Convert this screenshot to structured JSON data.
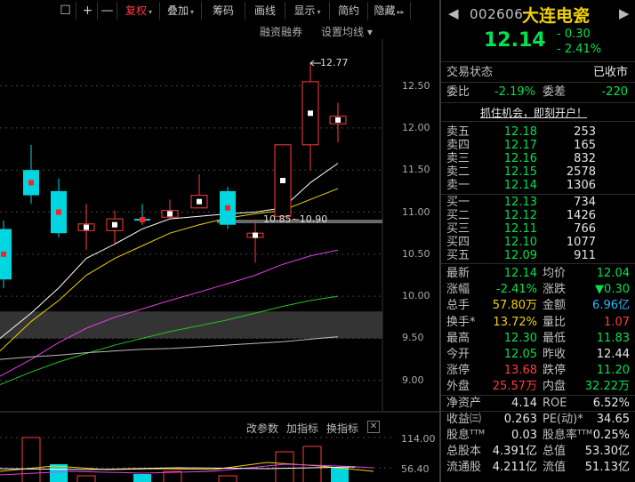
{
  "toolbar": {
    "items": [
      {
        "label": "☐",
        "icon": "window-icon"
      },
      {
        "label": "+",
        "icon": "zoom-in-icon"
      },
      {
        "label": "—",
        "icon": "zoom-out-icon"
      },
      {
        "label": "复权",
        "caret": "▾",
        "active": true
      },
      {
        "label": "叠加",
        "caret": "▾"
      },
      {
        "label": "筹码"
      },
      {
        "label": "画线"
      },
      {
        "label": "显示",
        "caret": "▾"
      },
      {
        "label": "简约"
      },
      {
        "label": "隐藏",
        "caret": "▸▸"
      }
    ],
    "margin_trading": "融资融券",
    "ma_setting": "设置均线 ▾"
  },
  "price_axis": [
    "12.50",
    "12.00",
    "11.50",
    "11.00",
    "10.50",
    "10.00",
    "9.50",
    "9.00"
  ],
  "annotations": {
    "high_label": "12.77",
    "range_label": "10.85~10.90"
  },
  "sub_panel": {
    "labels": [
      "改参数",
      "加指标",
      "换指标"
    ],
    "close": "✕",
    "axis": [
      "114.00",
      "56.40"
    ]
  },
  "chart_data": {
    "type": "candlestick",
    "candles": [
      {
        "open": 10.8,
        "close": 10.2,
        "high": 10.9,
        "low": 10.1
      },
      {
        "open": 11.5,
        "close": 11.2,
        "high": 11.8,
        "low": 11.1
      },
      {
        "open": 11.25,
        "close": 10.75,
        "high": 11.4,
        "low": 10.7
      },
      {
        "open": 10.78,
        "close": 10.86,
        "high": 11.1,
        "low": 10.55
      },
      {
        "open": 10.78,
        "close": 10.92,
        "high": 11.02,
        "low": 10.62
      },
      {
        "open": 10.92,
        "close": 10.9,
        "high": 11.1,
        "low": 10.85
      },
      {
        "open": 10.94,
        "close": 11.02,
        "high": 11.15,
        "low": 10.92
      },
      {
        "open": 11.05,
        "close": 11.2,
        "high": 11.45,
        "low": 11.05
      },
      {
        "open": 11.25,
        "close": 10.85,
        "high": 11.3,
        "low": 10.8
      },
      {
        "open": 10.7,
        "close": 10.75,
        "high": 10.9,
        "low": 10.4
      },
      {
        "open": 10.95,
        "close": 11.8,
        "high": 11.8,
        "low": 10.95
      },
      {
        "open": 11.8,
        "close": 12.55,
        "high": 12.77,
        "low": 11.5
      },
      {
        "open": 12.05,
        "close": 12.14,
        "high": 12.3,
        "low": 11.83
      }
    ],
    "ma_lines": [
      {
        "color": "#ffffff",
        "values": [
          9.5,
          9.8,
          10.1,
          10.45,
          10.62,
          10.8,
          10.92,
          10.95,
          10.98,
          11.0,
          11.05,
          11.35,
          11.58
        ]
      },
      {
        "color": "#f0d200",
        "values": [
          9.35,
          9.7,
          9.95,
          10.25,
          10.45,
          10.6,
          10.75,
          10.85,
          10.93,
          10.98,
          11.02,
          11.15,
          11.28
        ]
      },
      {
        "color": "#e040e0",
        "values": [
          9.05,
          9.25,
          9.45,
          9.62,
          9.75,
          9.85,
          9.95,
          10.05,
          10.15,
          10.25,
          10.38,
          10.48,
          10.55
        ]
      },
      {
        "color": "#22c322",
        "values": [
          8.95,
          9.1,
          9.22,
          9.32,
          9.42,
          9.5,
          9.58,
          9.65,
          9.72,
          9.8,
          9.88,
          9.95,
          10.0
        ]
      },
      {
        "color": "#bbbbbb",
        "values": [
          9.25,
          9.28,
          9.3,
          9.33,
          9.35,
          9.37,
          9.38,
          9.4,
          9.42,
          9.44,
          9.46,
          9.49,
          9.52
        ]
      }
    ],
    "support_band": [
      9.5,
      9.82
    ],
    "ylim": [
      8.85,
      12.95
    ]
  },
  "quote": {
    "code": "002606",
    "name": "大连电瓷",
    "price": "12.14",
    "change": "- 0.30",
    "change_pct": "- 2.41%",
    "status_label": "交易状态",
    "status_value": "已收市",
    "wb_label": "委比",
    "wb_value": "-2.19%",
    "wc_label": "委差",
    "wc_value": "-220",
    "promo": "抓住机会，即刻开户！"
  },
  "orderbook": {
    "asks": [
      {
        "label": "卖五",
        "price": "12.18",
        "vol": "253"
      },
      {
        "label": "卖四",
        "price": "12.17",
        "vol": "165"
      },
      {
        "label": "卖三",
        "price": "12.16",
        "vol": "832"
      },
      {
        "label": "卖二",
        "price": "12.15",
        "vol": "2578"
      },
      {
        "label": "卖一",
        "price": "12.14",
        "vol": "1306"
      }
    ],
    "bids": [
      {
        "label": "买一",
        "price": "12.13",
        "vol": "734"
      },
      {
        "label": "买二",
        "price": "12.12",
        "vol": "1426"
      },
      {
        "label": "买三",
        "price": "12.11",
        "vol": "766"
      },
      {
        "label": "买四",
        "price": "12.10",
        "vol": "1077"
      },
      {
        "label": "买五",
        "price": "12.09",
        "vol": "911"
      }
    ]
  },
  "stats": [
    {
      "l1": "最新",
      "v1": "12.14",
      "c1": "green",
      "l2": "均价",
      "v2": "12.04",
      "c2": "green"
    },
    {
      "l1": "涨幅",
      "v1": "-2.41%",
      "c1": "green",
      "l2": "涨跌",
      "v2": "▼0.30",
      "c2": "green"
    },
    {
      "l1": "总手",
      "v1": "57.80万",
      "c1": "yellow",
      "l2": "金额",
      "v2": "6.96亿",
      "c2": "cyan"
    },
    {
      "l1": "换手*",
      "v1": "13.72%",
      "c1": "yellow",
      "l2": "量比",
      "v2": "1.07",
      "c2": "red"
    },
    {
      "l1": "最高",
      "v1": "12.30",
      "c1": "green",
      "l2": "最低",
      "v2": "11.83",
      "c2": "green"
    },
    {
      "l1": "今开",
      "v1": "12.05",
      "c1": "green",
      "l2": "昨收",
      "v2": "12.44",
      "c2": "white"
    },
    {
      "l1": "涨停",
      "v1": "13.68",
      "c1": "red",
      "l2": "跌停",
      "v2": "11.20",
      "c2": "green"
    },
    {
      "l1": "外盘",
      "v1": "25.57万",
      "c1": "red",
      "l2": "内盘",
      "v2": "32.22万",
      "c2": "green"
    },
    {
      "l1": "净资产",
      "v1": "4.14",
      "c1": "white",
      "l2": "ROE",
      "v2": "6.52%",
      "c2": "white"
    },
    {
      "l1": "收益㈢",
      "v1": "0.263",
      "c1": "white",
      "l2": "PE(动)*",
      "v2": "34.65",
      "c2": "white"
    },
    {
      "l1": "股息ᵀᵀᴹ",
      "v1": "0.03",
      "c1": "white",
      "l2": "股息率ᵀᵀᴹ",
      "v2": "0.25%",
      "c2": "white"
    },
    {
      "l1": "总股本",
      "v1": "4.391亿",
      "c1": "white",
      "l2": "总值",
      "v2": "53.30亿",
      "c2": "white"
    },
    {
      "l1": "流通股",
      "v1": "4.211亿",
      "c1": "white",
      "l2": "流值",
      "v2": "51.13亿",
      "c2": "white"
    }
  ]
}
